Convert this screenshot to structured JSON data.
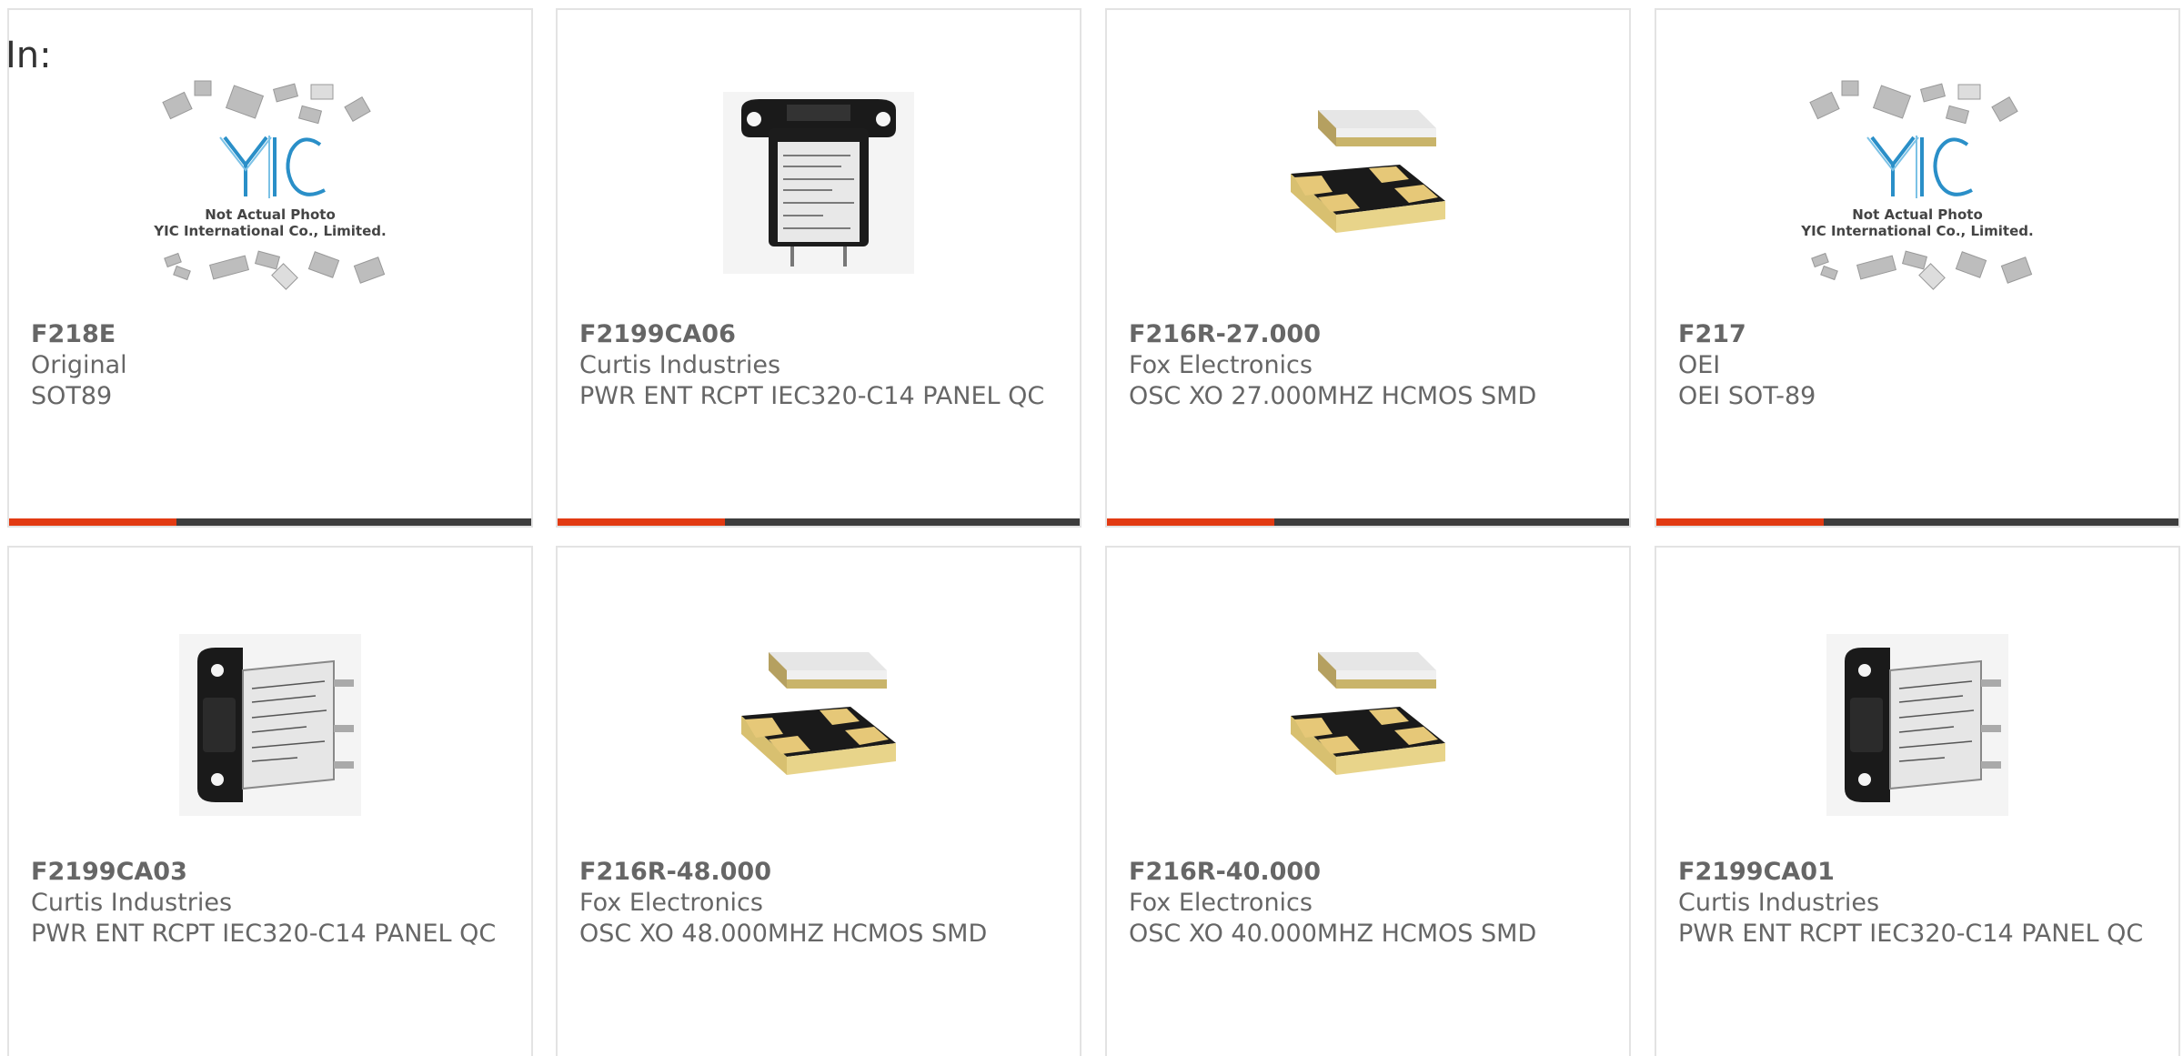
{
  "in_label": "In:",
  "placeholder_image": {
    "caption_line1": "Not Actual Photo",
    "caption_line2": "YIC International Co., Limited.",
    "logo": "YIC"
  },
  "products": [
    {
      "part": "F218E",
      "maker": "Original",
      "desc": "SOT89",
      "image": "placeholder"
    },
    {
      "part": "F2199CA06",
      "maker": "Curtis Industries",
      "desc": "PWR ENT RCPT IEC320-C14 PANEL QC",
      "image": "power-entry-front"
    },
    {
      "part": "F216R-27.000",
      "maker": "Fox Electronics",
      "desc": "OSC XO 27.000MHZ HCMOS SMD",
      "image": "crystal-oscillator"
    },
    {
      "part": "F217",
      "maker": "OEI",
      "desc": "OEI SOT-89",
      "image": "placeholder"
    },
    {
      "part": "F2199CA03",
      "maker": "Curtis Industries",
      "desc": "PWR ENT RCPT IEC320-C14 PANEL QC",
      "image": "power-entry-side"
    },
    {
      "part": "F216R-48.000",
      "maker": "Fox Electronics",
      "desc": "OSC XO 48.000MHZ HCMOS SMD",
      "image": "crystal-oscillator"
    },
    {
      "part": "F216R-40.000",
      "maker": "Fox Electronics",
      "desc": "OSC XO 40.000MHZ HCMOS SMD",
      "image": "crystal-oscillator"
    },
    {
      "part": "F2199CA01",
      "maker": "Curtis Industries",
      "desc": "PWR ENT RCPT IEC320-C14 PANEL QC",
      "image": "power-entry-side"
    }
  ],
  "colors": {
    "accent": "#e23a12",
    "bar": "#3d3d3d",
    "text": "#666666",
    "border": "#e3e3e3"
  }
}
